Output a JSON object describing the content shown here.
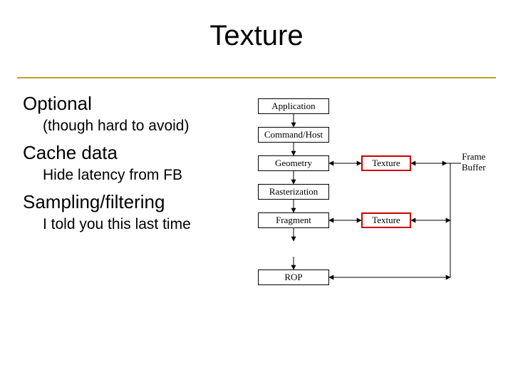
{
  "title": "Texture",
  "points": {
    "optional": "Optional",
    "optional_sub": "(though hard to avoid)",
    "cache": "Cache data",
    "cache_sub": "Hide latency from FB",
    "sampling": "Sampling/filtering",
    "sampling_sub": "I told you this last time"
  },
  "diagram": {
    "application": "Application",
    "command": "Command/Host",
    "geometry": "Geometry",
    "rasterization": "Rasterization",
    "fragment": "Fragment",
    "rop": "ROP",
    "texture_top": "Texture",
    "texture_bottom": "Texture",
    "frame_buffer_l1": "Frame",
    "frame_buffer_l2": "Buffer"
  }
}
